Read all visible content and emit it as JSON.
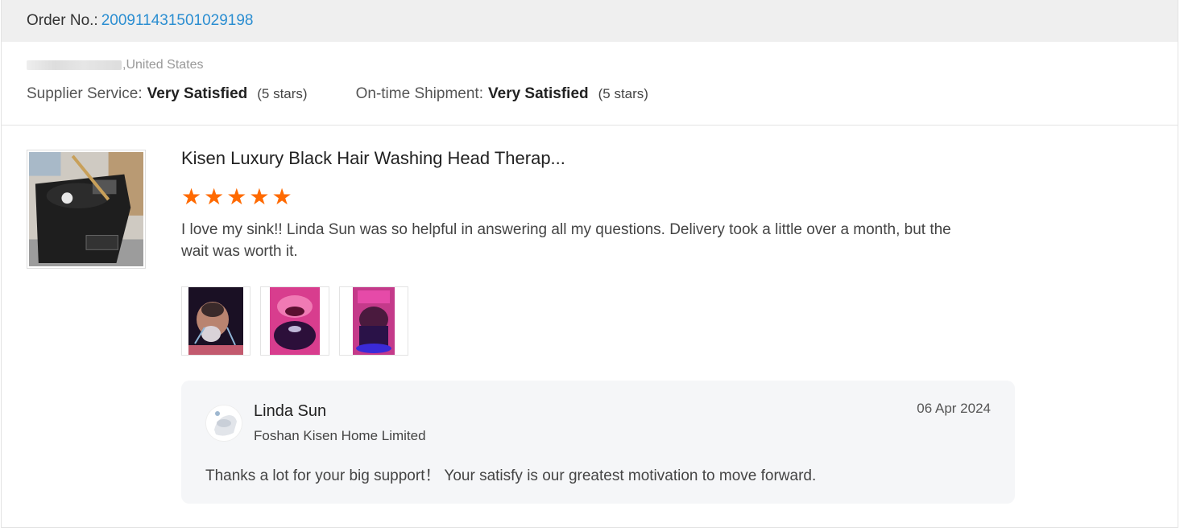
{
  "order": {
    "label": "Order No.:",
    "number": "200911431501029198"
  },
  "buyer": {
    "location_suffix": ",United States",
    "supplier_service": {
      "label": "Supplier Service:",
      "value": "Very Satisfied",
      "stars_text": "(5 stars)"
    },
    "on_time_shipment": {
      "label": "On-time Shipment:",
      "value": "Very Satisfied",
      "stars_text": "(5 stars)"
    }
  },
  "review": {
    "product_title": "Kisen Luxury Black Hair Washing Head Therap...",
    "rating": 5,
    "star_glyph": "★",
    "text": "I love my sink!! Linda Sun was so helpful in answering all my questions. Delivery took a little over a month, but the wait was worth it.",
    "photos": [
      "photo-1",
      "photo-2",
      "photo-3"
    ]
  },
  "reply": {
    "name": "Linda Sun",
    "company": "Foshan Kisen Home Limited",
    "date": "06 Apr 2024",
    "text": "Thanks a lot for your big support！  Your satisfy is our greatest motivation to move forward."
  },
  "colors": {
    "accent_link": "#2b8ed1",
    "star": "#ff6a00",
    "header_bg": "#efefef",
    "reply_bg": "#f5f6f8"
  }
}
